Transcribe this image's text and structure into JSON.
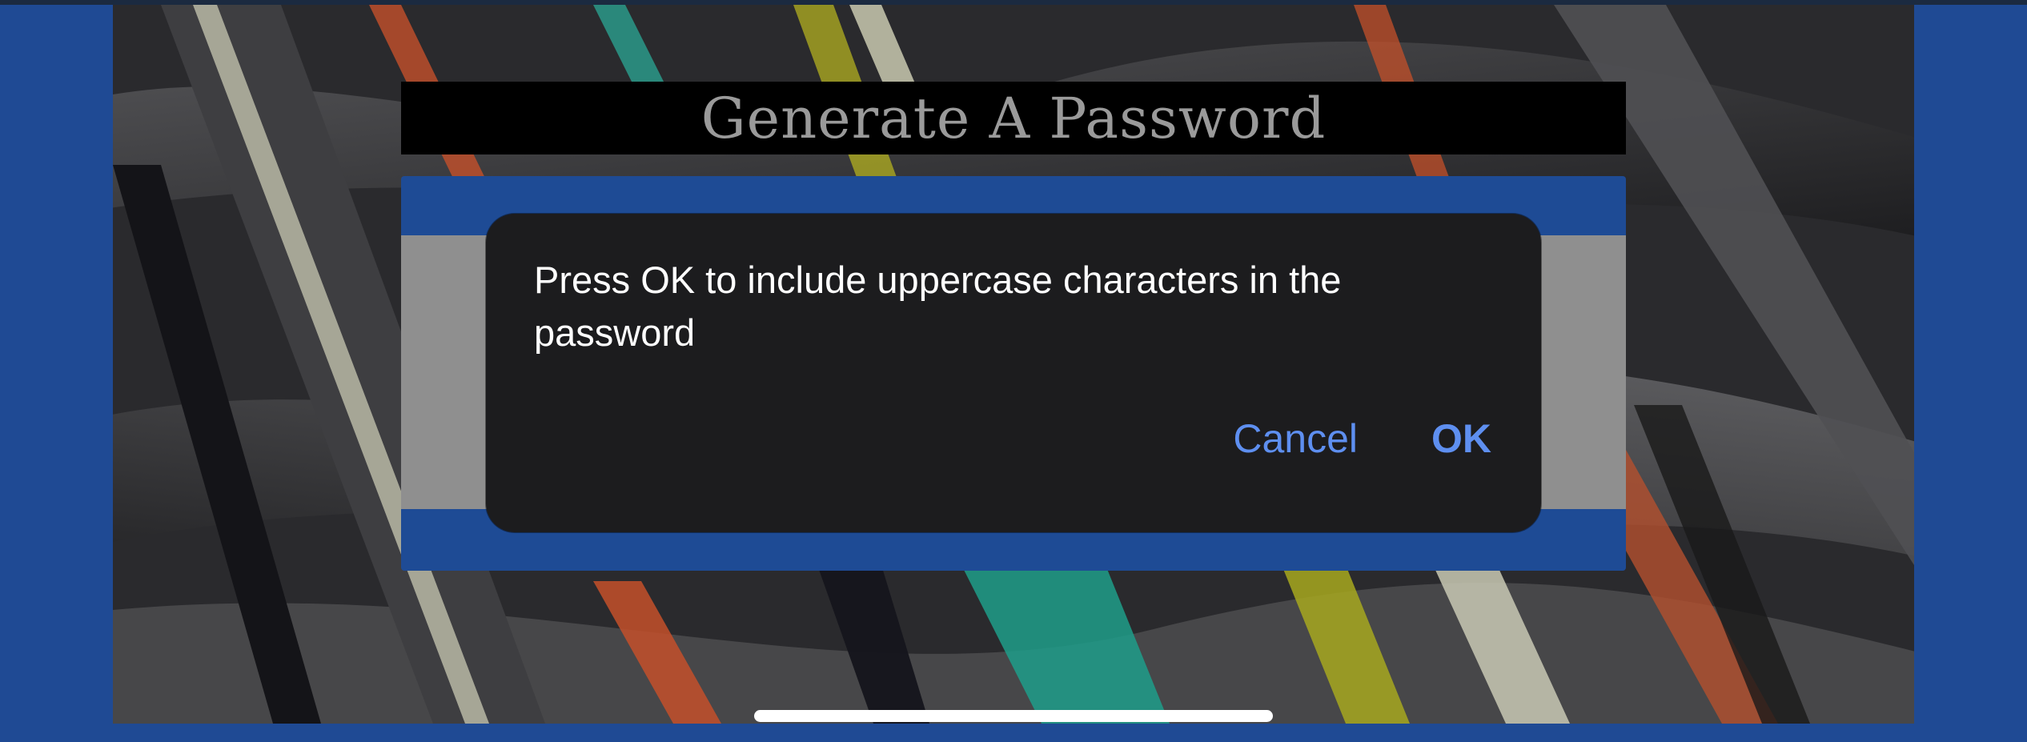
{
  "page": {
    "title": "Generate A Password"
  },
  "dialog": {
    "message": "Press OK to include uppercase characters in the password",
    "cancel_label": "Cancel",
    "ok_label": "OK"
  },
  "colors": {
    "frame_blue": "#1f4a94",
    "card_blue": "#1e4b95",
    "dialog_bg": "#1c1c1e",
    "button_blue": "#5e8ff0",
    "title_gray": "#9a9a9a"
  },
  "icons": {
    "home_indicator": "home-indicator-bar"
  }
}
